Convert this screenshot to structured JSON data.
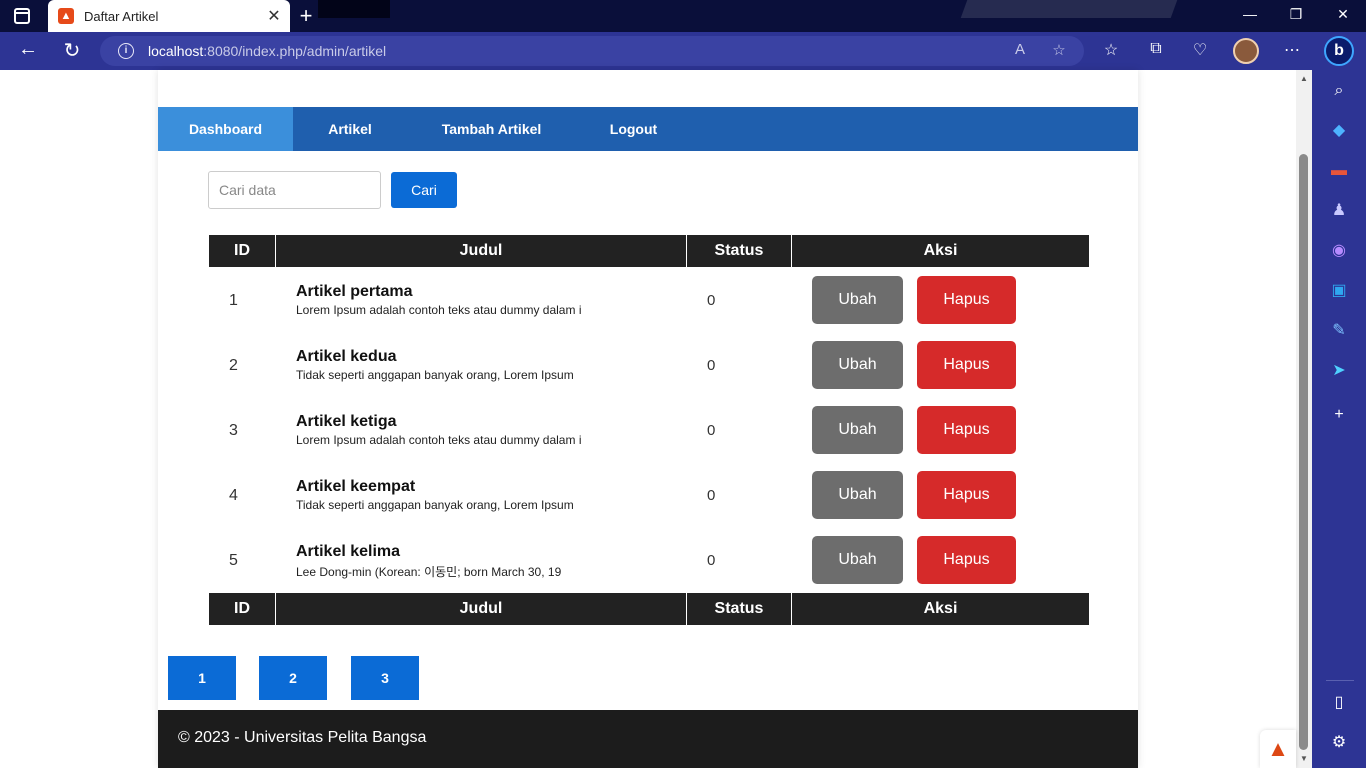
{
  "browser": {
    "tab_title": "Daftar Artikel",
    "url_host": "localhost",
    "url_path": ":8080/index.php/admin/artikel"
  },
  "nav": {
    "items": [
      {
        "label": "Dashboard",
        "active": true
      },
      {
        "label": "Artikel",
        "active": false
      },
      {
        "label": "Tambah Artikel",
        "active": false
      },
      {
        "label": "Logout",
        "active": false
      }
    ]
  },
  "search": {
    "placeholder": "Cari data",
    "value": "",
    "button_label": "Cari"
  },
  "table": {
    "headers": [
      "ID",
      "Judul",
      "Status",
      "Aksi"
    ],
    "rows": [
      {
        "id": "1",
        "title": "Artikel pertama",
        "excerpt": "Lorem Ipsum adalah contoh teks atau dummy dalam i",
        "status": "0",
        "edit_label": "Ubah",
        "delete_label": "Hapus"
      },
      {
        "id": "2",
        "title": "Artikel kedua",
        "excerpt": "Tidak seperti anggapan banyak orang, Lorem Ipsum",
        "status": "0",
        "edit_label": "Ubah",
        "delete_label": "Hapus"
      },
      {
        "id": "3",
        "title": "Artikel ketiga",
        "excerpt": "Lorem Ipsum adalah contoh teks atau dummy dalam i",
        "status": "0",
        "edit_label": "Ubah",
        "delete_label": "Hapus"
      },
      {
        "id": "4",
        "title": "Artikel keempat",
        "excerpt": "Tidak seperti anggapan banyak orang, Lorem Ipsum",
        "status": "0",
        "edit_label": "Ubah",
        "delete_label": "Hapus"
      },
      {
        "id": "5",
        "title": "Artikel kelima",
        "excerpt": "Lee Dong-min (Korean: 이동민; born March 30, 19",
        "status": "0",
        "edit_label": "Ubah",
        "delete_label": "Hapus"
      }
    ]
  },
  "pagination": {
    "pages": [
      "1",
      "2",
      "3"
    ]
  },
  "footer": {
    "text": "© 2023 - Universitas Pelita Bangsa"
  },
  "colors": {
    "nav_bg": "#1f5fae",
    "nav_active": "#3b8fdb",
    "primary_button": "#0b6bd6",
    "edit_button": "#6d6d6d",
    "delete_button": "#d62a2a",
    "table_header": "#222222",
    "footer_bg": "#1c1c1c",
    "browser_frame": "#2d3494"
  },
  "icons": {
    "sidebar": [
      "search-icon",
      "tag-icon",
      "toolbox-icon",
      "people-icon",
      "office-icon",
      "outlook-icon",
      "designer-icon",
      "send-icon",
      "plus-icon"
    ]
  }
}
